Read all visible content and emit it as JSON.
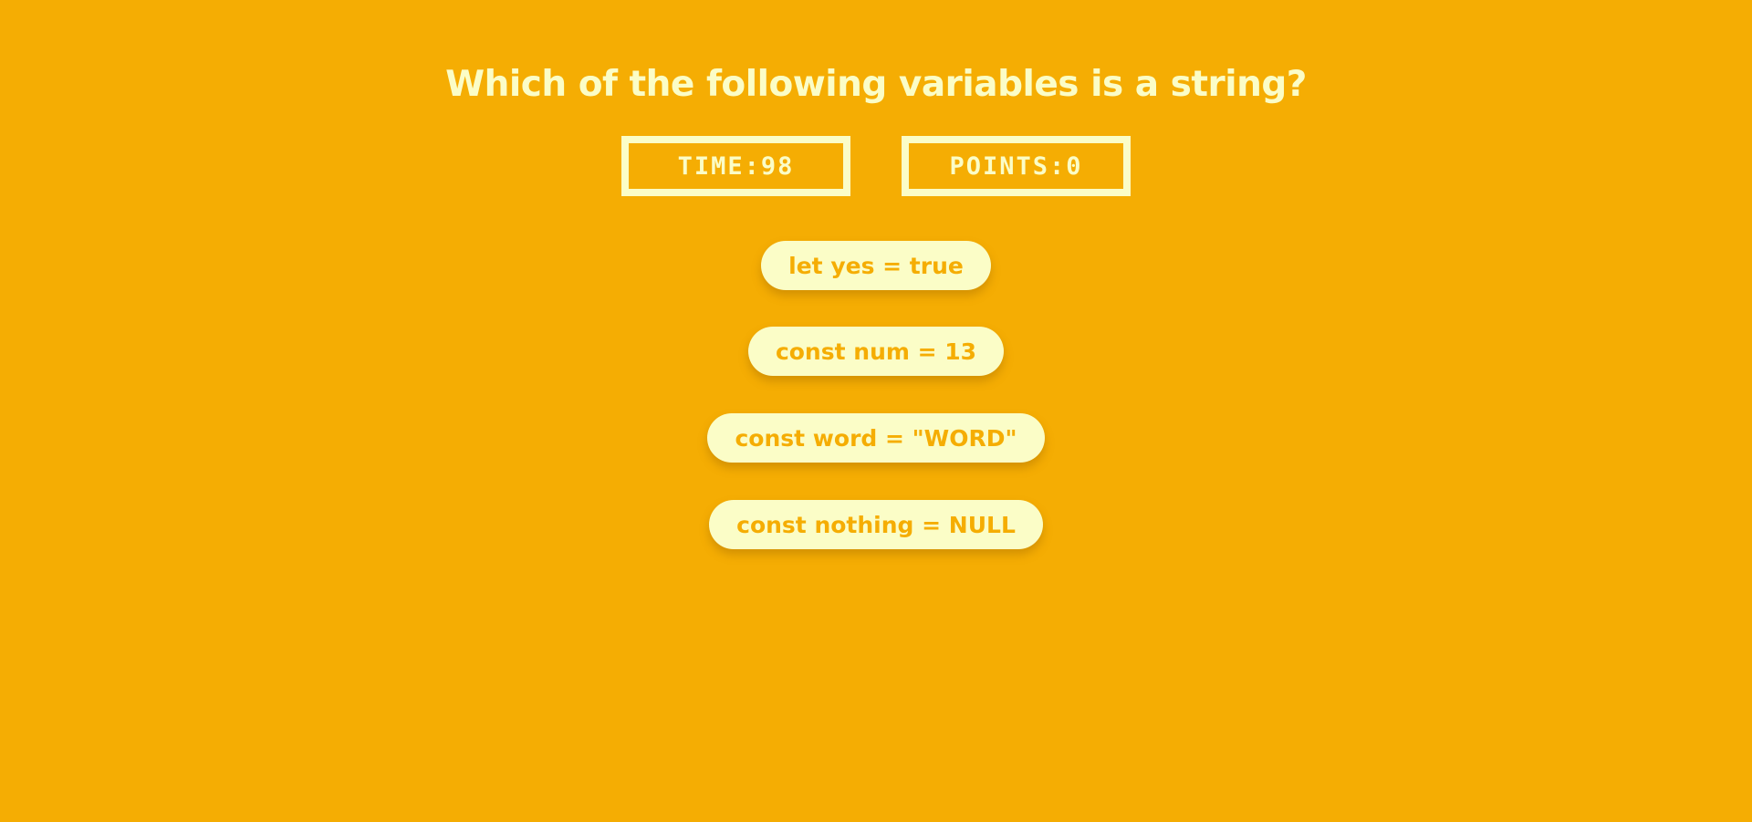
{
  "quiz": {
    "question": "Which of the following variables is a string?",
    "time": {
      "label": "TIME:",
      "value": "98"
    },
    "points": {
      "label": "POINTS:",
      "value": "0"
    },
    "answers": [
      "let yes = true",
      "const num = 13",
      "const word = \"WORD\"",
      "const nothing = NULL"
    ]
  },
  "colors": {
    "background": "#f5ad03",
    "light": "#fbfdc7"
  }
}
